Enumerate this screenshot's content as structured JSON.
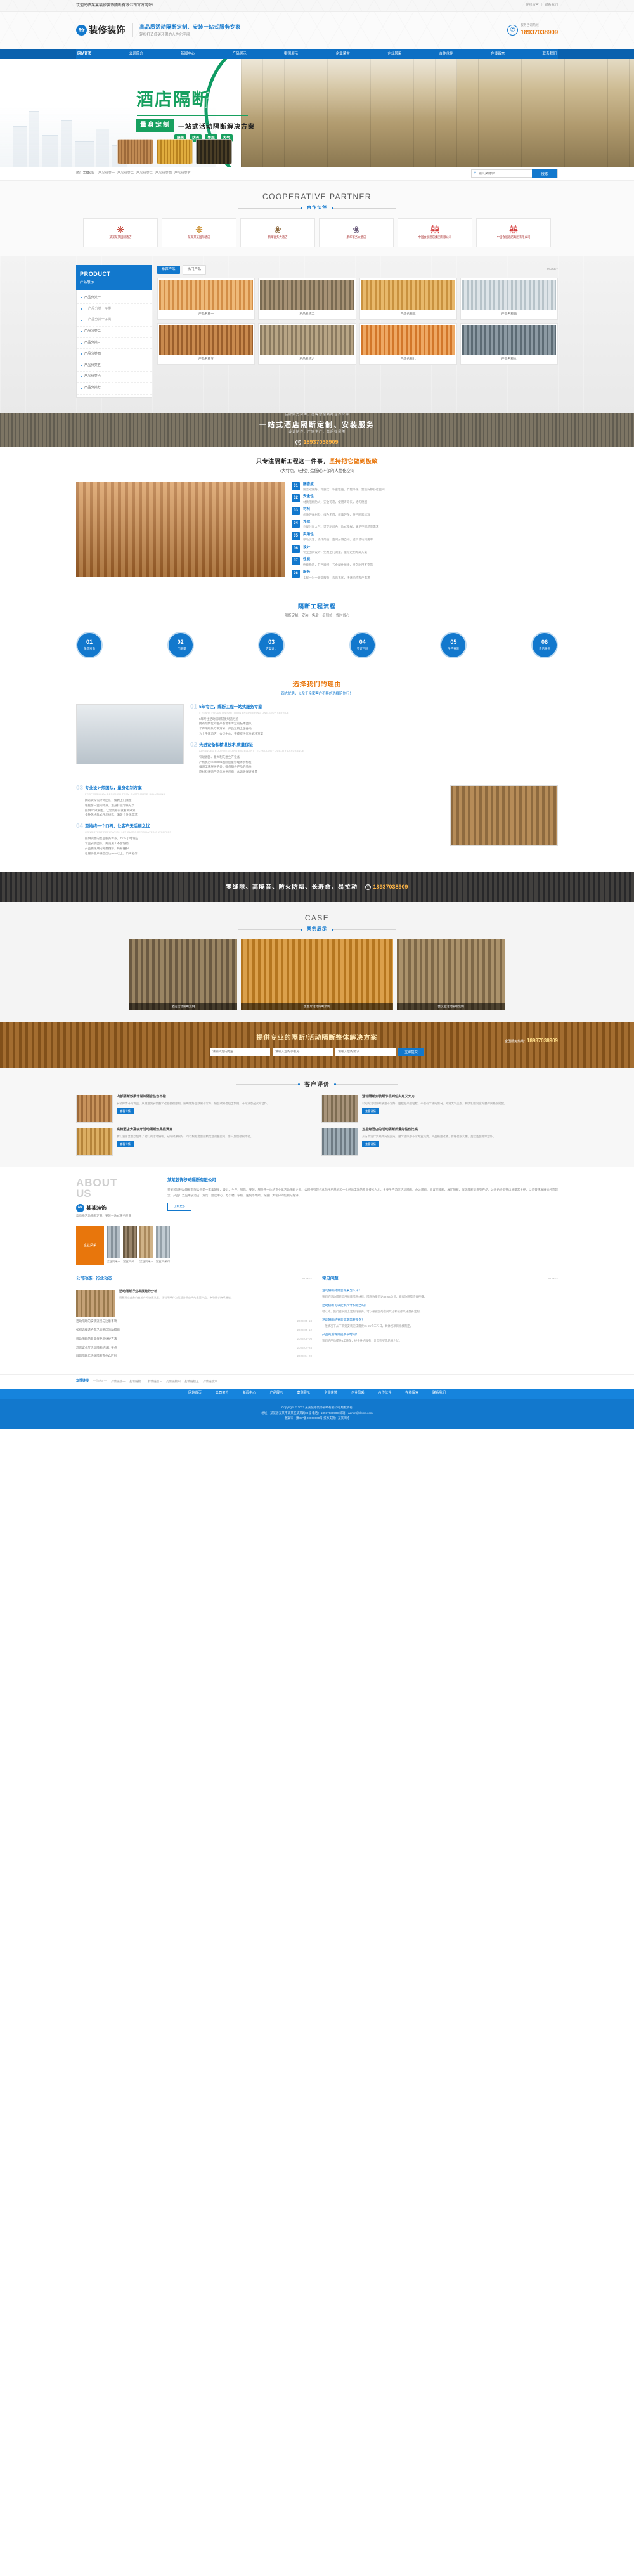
{
  "topbar": {
    "welcome": "欢迎光临某某装修装饰隔断有限公司官方网站!",
    "links": [
      "在线留言",
      "联系我们"
    ],
    "divider": "|"
  },
  "header": {
    "logo_mark": "Mr",
    "logo_text": "装修装饰",
    "slogan_main": "高品质活动隔断定制、安装一站式服务专家",
    "slogan_sub": "轻松打造低碳环保的人性化空间",
    "tel_icon": "phone-icon",
    "tel_label": "服务咨询热线",
    "tel_number": "18937038909"
  },
  "nav": {
    "items": [
      {
        "label": "网站首页",
        "active": true
      },
      {
        "label": "公司简介",
        "active": false
      },
      {
        "label": "新闻中心",
        "active": false
      },
      {
        "label": "产品展示",
        "active": false
      },
      {
        "label": "案例展示",
        "active": false
      },
      {
        "label": "企业荣誉",
        "active": false
      },
      {
        "label": "企业风采",
        "active": false
      },
      {
        "label": "合作伙伴",
        "active": false
      },
      {
        "label": "在线留言",
        "active": false
      },
      {
        "label": "联系我们",
        "active": false
      }
    ]
  },
  "banner": {
    "title": "酒店隔断",
    "badge": "量身定制",
    "subtitle": "一站式活动隔断解决方案",
    "tags": [
      "隔热",
      "防火",
      "美观",
      "大气"
    ]
  },
  "search": {
    "keywords_label": "热门关键词：",
    "keywords": [
      "产品分类一",
      "产品分类二",
      "产品分类三",
      "产品分类四",
      "产品分类五"
    ],
    "placeholder": "输入关键字",
    "button": "搜索",
    "icon": "search-icon"
  },
  "partners": {
    "en": "COOPERATIVE PARTNER",
    "cn": "合作伙伴",
    "items": [
      {
        "seal": "❋",
        "name": "某某某某国际酒店"
      },
      {
        "seal": "❋",
        "name": "某某某某国际酒店"
      },
      {
        "seal": "❀",
        "name": "鹏华富务大酒店"
      },
      {
        "seal": "❀",
        "name": "鹏华富务大酒店"
      },
      {
        "seal": "囍",
        "name": "中国会展酒店集团有限公司"
      },
      {
        "seal": "囍",
        "name": "中国会展酒店集团有限公司"
      }
    ]
  },
  "products": {
    "side_en": "PRODUCT",
    "side_cn": "产品展示",
    "categories": [
      {
        "label": "产品分类一",
        "sub": false
      },
      {
        "label": "产品分类一子类",
        "sub": true
      },
      {
        "label": "产品分类一子类",
        "sub": true
      },
      {
        "label": "产品分类二",
        "sub": false
      },
      {
        "label": "产品分类三",
        "sub": false
      },
      {
        "label": "产品分类四",
        "sub": false
      },
      {
        "label": "产品分类五",
        "sub": false
      },
      {
        "label": "产品分类六",
        "sub": false
      },
      {
        "label": "产品分类七",
        "sub": false
      }
    ],
    "tab_active": "推荐产品",
    "tab_alt": "热门产品",
    "more": "MORE+",
    "items": [
      {
        "name": "产品名称一"
      },
      {
        "name": "产品名称二"
      },
      {
        "name": "产品名称三"
      },
      {
        "name": "产品名称四"
      },
      {
        "name": "产品名称五"
      },
      {
        "name": "产品名称六"
      },
      {
        "name": "产品名称七"
      },
      {
        "name": "产品名称八"
      }
    ]
  },
  "adbar": {
    "line1": "品牌实力保障，值得您信赖的合作伙伴",
    "line2": "一站式酒店隔断定制、安装服务",
    "line3": "设计制作、厂家生产、售后有保障",
    "tel_icon": "phone-icon",
    "tel_number": "18937038909"
  },
  "advantage": {
    "title_pre": "只专注隔断工程这一件事，",
    "title_em": "坚持把它做到极致",
    "subtitle": "8大特点，轻松打造低碳环保的人性化空间",
    "items": [
      {
        "no": "01",
        "title": "隔音度",
        "desc": "隔音效果好，材质优，私密性强，节能环保，营造安静舒适空间"
      },
      {
        "no": "02",
        "title": "安全性",
        "desc": "材质阻燃防火，安全可靠，使用寿命长，结构稳固"
      },
      {
        "no": "03",
        "title": "材料",
        "desc": "优质环保材料，绿色无醛，健康环保，符合国家标准"
      },
      {
        "no": "04",
        "title": "外观",
        "desc": "外观时尚大气，可定制颜色，款式多样，满足不同场景需求"
      },
      {
        "no": "05",
        "title": "实用性",
        "desc": "移动灵活，操作简便，空间分隔自如，提高场地利用率"
      },
      {
        "no": "06",
        "title": "设计",
        "desc": "专业团队设计，免费上门测量，量身定制专属方案"
      },
      {
        "no": "07",
        "title": "性能",
        "desc": "性能稳定，开合顺畅，五金配件优质，经久耐用不变形"
      },
      {
        "no": "08",
        "title": "服务",
        "desc": "全程一对一跟踪服务，售后无忧，快速响应客户需求"
      }
    ]
  },
  "process": {
    "title": "隔断工程流程",
    "subtitle": "隔断定制、安装、售后一步到位，省时省心",
    "steps": [
      {
        "no": "01",
        "label": "免费咨询"
      },
      {
        "no": "02",
        "label": "上门测量"
      },
      {
        "no": "03",
        "label": "方案设计"
      },
      {
        "no": "04",
        "label": "签订合同"
      },
      {
        "no": "05",
        "label": "生产安装"
      },
      {
        "no": "06",
        "label": "售后服务"
      }
    ]
  },
  "reason": {
    "title": "选择我们的理由",
    "subtitle": "四大优势，以及千余家客户不移的选择陪你行！",
    "blocks": [
      {
        "q": "01",
        "title": "5年专注，隔断工程一站式服务专家",
        "en": "5 YEARS FOCUS ON PARTITION ENGINEERING ONE-STOP SERVICE",
        "lines": [
          "5年专注活动隔断研发制造经验",
          "拥有现代化的生产基地和专业的技术团队",
          "年产隔断数万平方米，产品远销全国各地",
          "为上千家酒店、会议中心、学校提供优质解决方案"
        ]
      },
      {
        "q": "02",
        "title": "先进设备和精湛技术,质量保证",
        "en": "ADVANCED EQUIPMENT AND EXCELLENT TECHNOLOGY QUALITY ASSURANCE",
        "lines": [
          "引进德国、意大利先进生产设备",
          "严格执行ISO9001国际质量管理体系标准",
          "每道工序层层把关，确保每件产品的品质",
          "原材料采购严选优质供应商，从源头保证质量"
        ]
      },
      {
        "q": "03",
        "title": "专业设计师团队，量身定制方案",
        "en": "PROFESSIONAL DESIGNER TEAM CUSTOMIZED SOLUTIONS",
        "lines": [
          "拥有资深设计师团队，免费上门测量",
          "根据客户空间特点，量身打造专属方案",
          "提供3D效果图，让您装修前就看到效果",
          "多种风格款式任您挑选，满足个性化需求"
        ]
      },
      {
        "q": "04",
        "title": "至始终一个口碑，让客户无后顾之忧",
        "en": "CONSISTENT REPUTATION LET CUSTOMERS HAVE NO WORRIES",
        "lines": [
          "提供完善的售后服务体系，7×24小时响应",
          "专业安装团队，规范施工不留隐患",
          "产品质保期内免费维修，终身维护",
          "已服务客户满意度达98%以上，口碑相传"
        ]
      }
    ]
  },
  "cta2": {
    "text": "零缝隙、高隔音、防火防烟、长寿命、易拉动",
    "tel_icon": "phone-icon",
    "tel_number": "18937038909"
  },
  "cases": {
    "en": "CASE",
    "cn": "案例展示",
    "items": [
      {
        "caption": "酒店活动隔断案例"
      },
      {
        "caption": "宴会厅活动隔断案例"
      },
      {
        "caption": "会议室活动隔断案例"
      }
    ]
  },
  "cta3": {
    "title": "提供专业的隔断/活动隔断整体解决方案",
    "name_placeholder": "请输入您的姓名",
    "phone_placeholder": "请输入您的手机号",
    "demand_placeholder": "请输入您的需求",
    "submit": "立即提交",
    "hotline_label": "全国服务热线：",
    "hotline": "18937038909"
  },
  "reviews": {
    "title": "客户评价",
    "items": [
      {
        "title": "内部隔断效果非常好隔音性也不错",
        "text": "安装师傅非常专业，从测量到安装整个过程都很顺利，隔断做好后效果非常好，隔音效果也超出预期，非常满意这次的合作。",
        "more": "查看详情"
      },
      {
        "title": "活动隔断安装细节很到位实用又大方",
        "text": "公司的活动隔断质量非常好，推拉起来很轻松，不会有卡顿的情况。外观大气美观，和我们会议室的整体风格很搭配。",
        "more": "查看详情"
      },
      {
        "title": "高档酒店大宴会厅活动隔断效果很满意",
        "text": "我们酒店宴会厅使用了他们的活动隔断，分隔效果很好，可以根据宴会规模灵活调整空间，客户反馈都很不错。",
        "more": "查看详情"
      },
      {
        "title": "五星级酒店的活动隔断质量好性价比高",
        "text": "从方案设计到最终安装完成，整个团队都非常专业负责。产品质量过硬，价格也很实惠，后续还会继续合作。",
        "more": "查看详情"
      }
    ]
  },
  "about": {
    "big1": "ABOUT",
    "big2": "US",
    "logo_mark": "Mr",
    "logo_text": "某某装饰",
    "tagline": "高品质活动隔断定制、安装一站式服务专家",
    "heading": "某某装饰移动隔断有限公司",
    "text": "某某装饰移动隔断有限公司是一家集研发、设计、生产、销售、安装、服务于一体的专业化活动隔断企业。公司拥有现代化的生产基地和一批经验丰富的专业技术人才，主要生产酒店活动隔断、办公隔断、会议室隔断、展厅隔断、屏风隔断等系列产品。公司始终坚持以质量求生存、以信誉求发展的经营理念，产品广泛应用于酒店、宾馆、会议中心、办公楼、学校、医院等场所，深受广大客户的信赖与好评。",
    "button": "了解更多",
    "nav_label": "企业风采",
    "gallery": [
      {
        "caption": "企业风采一"
      },
      {
        "caption": "企业风采二"
      },
      {
        "caption": "企业风采三"
      },
      {
        "caption": "企业风采四"
      }
    ]
  },
  "news": {
    "left_title": "公司动态 · 行业动态",
    "left_more": "MORE+",
    "top": {
      "title": "活动隔断行业发展趋势分析",
      "text": "随着酒店业和商业地产的快速发展，活动隔断作为灵活分隔空间的重要产品，市场需求持续增长。"
    },
    "list": [
      {
        "title": "活动隔断的安装流程与注意事项",
        "date": "2023-05-18"
      },
      {
        "title": "如何选择适合自己的酒店活动隔断",
        "date": "2023-05-12"
      },
      {
        "title": "移动隔断的日常保养与维护方法",
        "date": "2023-05-06"
      },
      {
        "title": "酒店宴会厅活动隔断的设计要点",
        "date": "2023-04-28"
      },
      {
        "title": "屏风隔断与活动隔断有什么区别",
        "date": "2023-04-20"
      }
    ],
    "right_title": "常见问题",
    "right_more": "MORE+",
    "faq": [
      {
        "q": "活动隔断的隔音效果怎么样？",
        "a": "我们的活动隔断采用优质隔音材料，隔音效果可达40-55分贝，能有效阻隔声音传播。"
      },
      {
        "q": "活动隔断可以定制尺寸和颜色吗？",
        "a": "可以的，我们提供完全定制化服务，可以根据您的空间尺寸和装修风格量身定制。"
      },
      {
        "q": "活动隔断的安装周期需要多久？",
        "a": "一般情况下从下单到安装完成需要15-25个工作日，具体视项目规模而定。"
      },
      {
        "q": "产品的质保期是多长时间？",
        "a": "我们的产品提供3年质保，终身维护服务，让您购买无后顾之忧。"
      }
    ]
  },
  "flinks": {
    "label": "友情链接",
    "sep": "— links —",
    "items": [
      "友情链接一",
      "友情链接二",
      "友情链接三",
      "友情链接四",
      "友情链接五",
      "友情链接六"
    ]
  },
  "footer": {
    "nav": [
      "网站首页",
      "公司简介",
      "新闻中心",
      "产品展示",
      "案例展示",
      "企业荣誉",
      "企业风采",
      "合作伙伴",
      "在线留言",
      "联系我们"
    ],
    "copyright": "Copyright © 2023 某某装修装饰隔断有限公司 版权所有",
    "info": "地址：某某省某某市某某区某某路88号   电话：18937038909   邮箱：admin@demo.com",
    "icp": "备案号：豫ICP备00000000号   技术支持：某某网络"
  },
  "colors": {
    "primary": "#1278cd",
    "accent": "#e8760c",
    "green": "#17a05f"
  }
}
